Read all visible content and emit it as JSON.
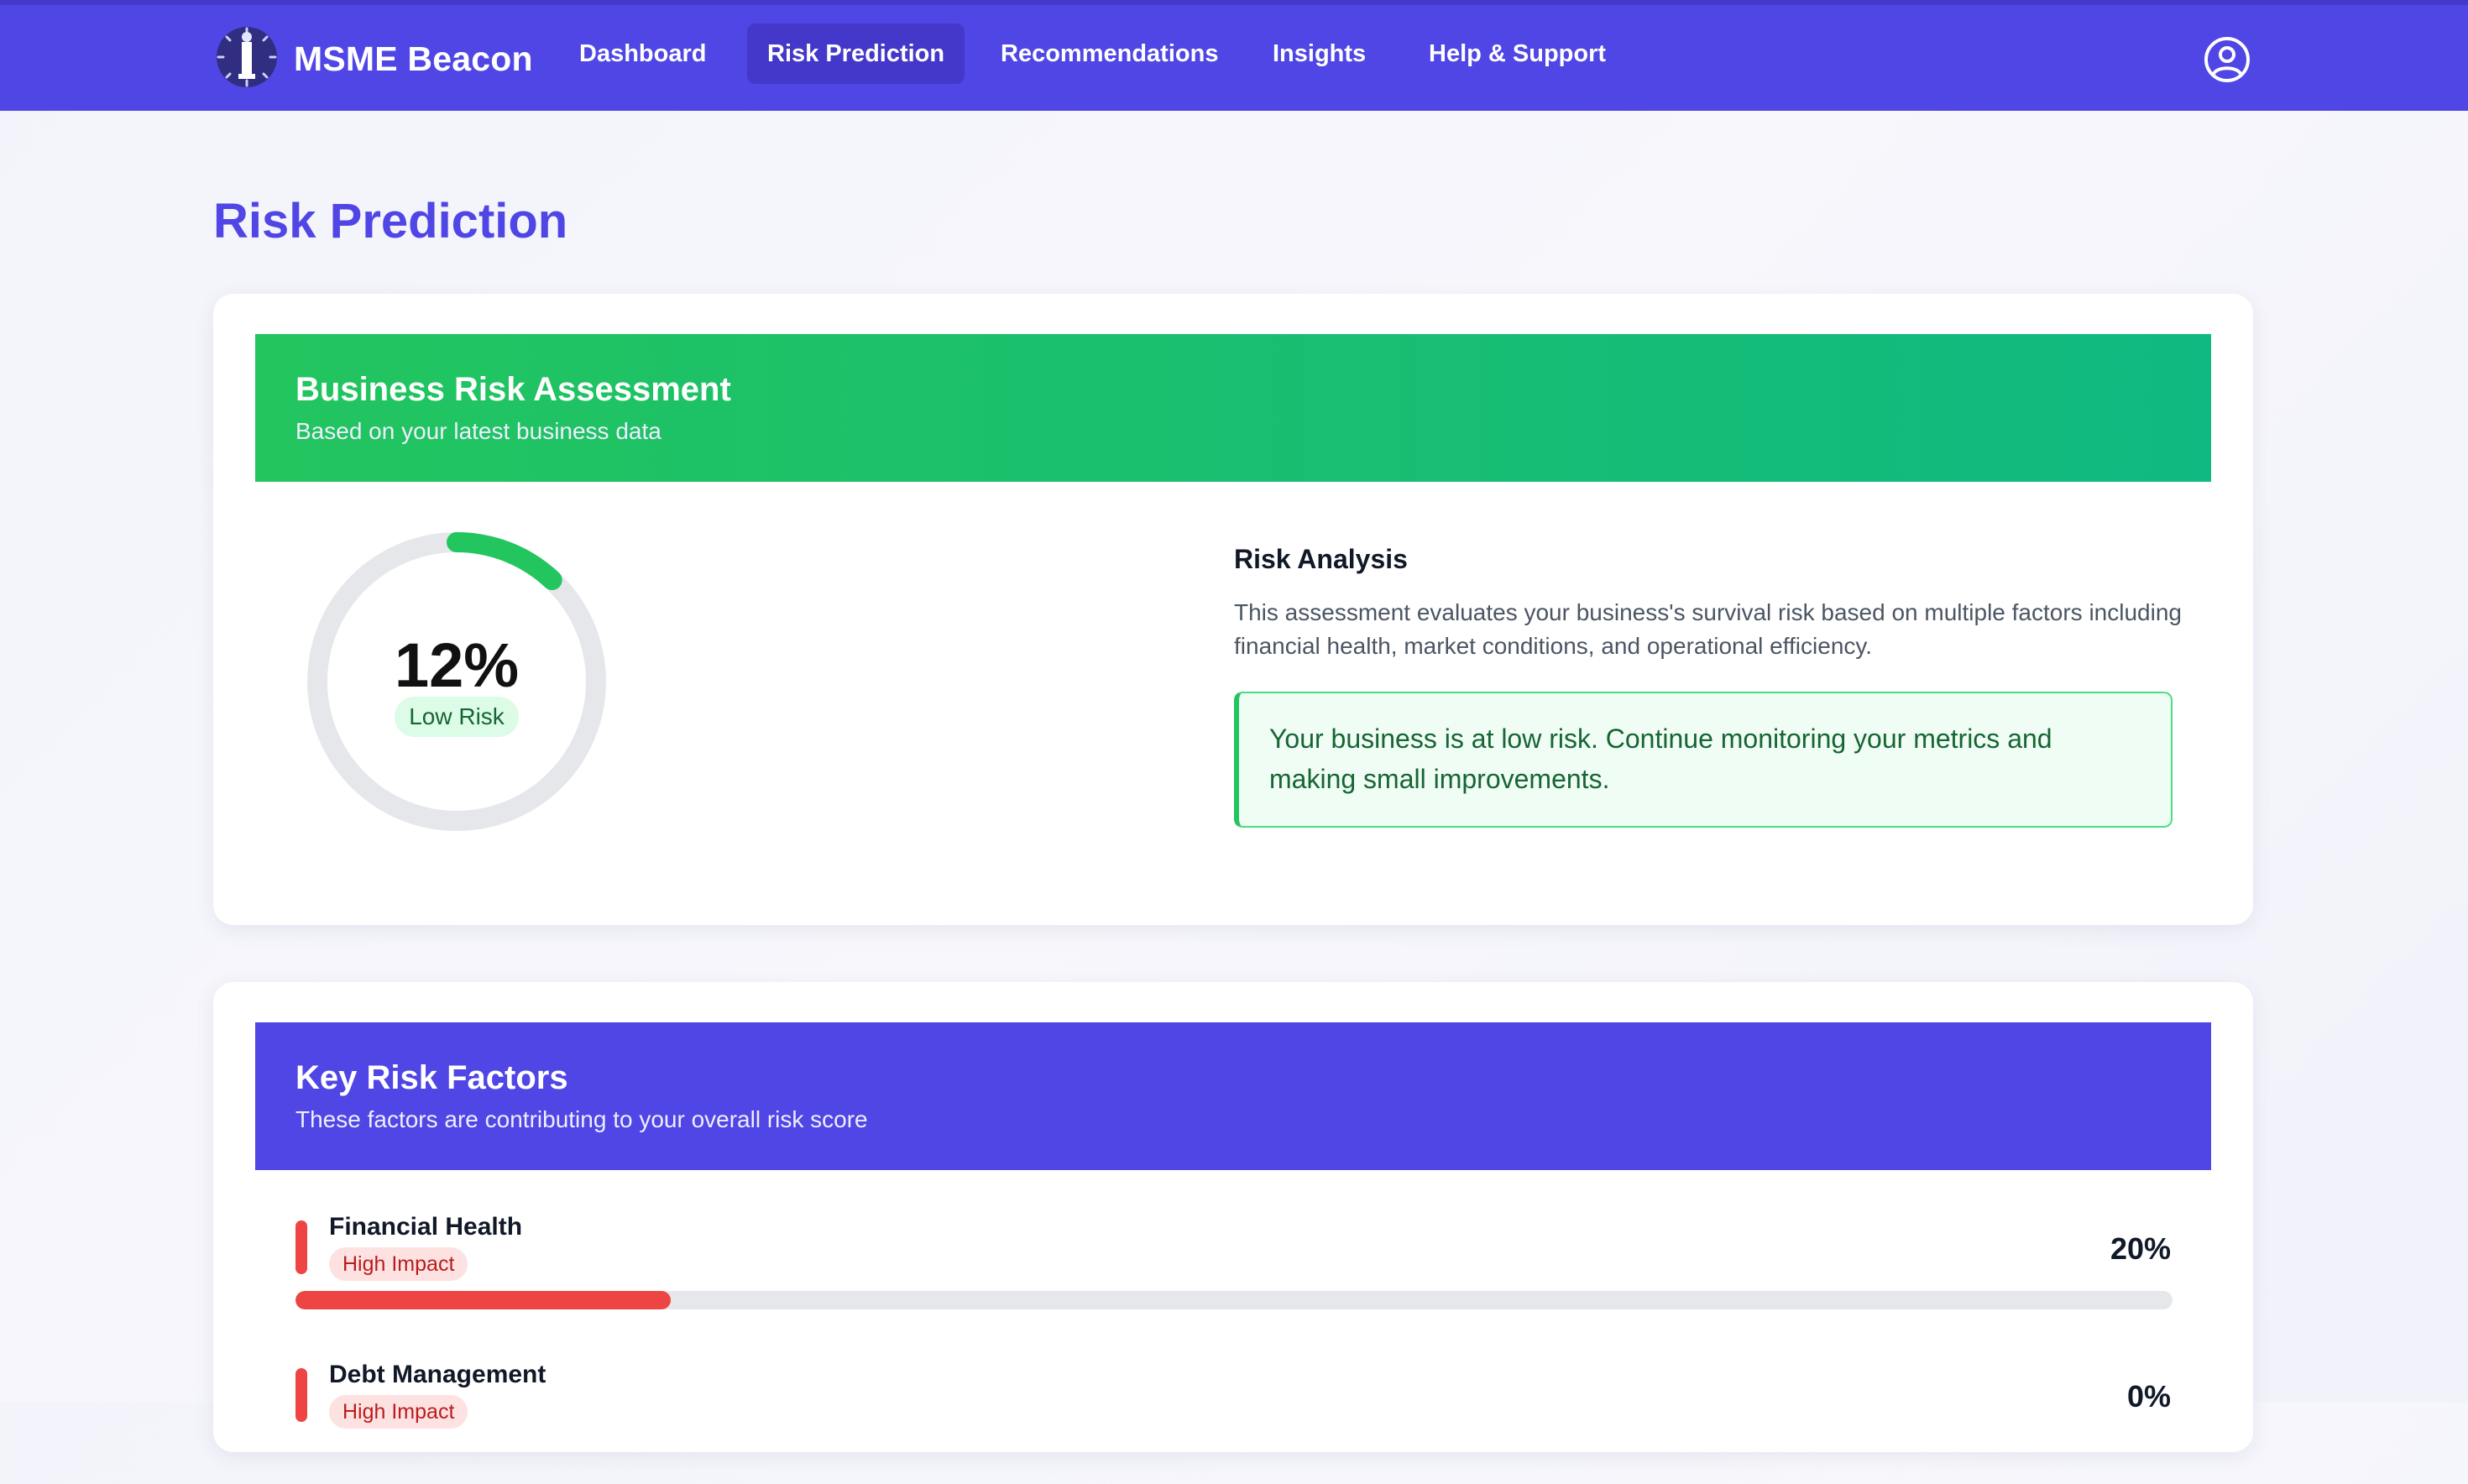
{
  "nav": {
    "brand": "MSME Beacon",
    "items": [
      {
        "label": "Dashboard",
        "active": false
      },
      {
        "label": "Risk Prediction",
        "active": true
      },
      {
        "label": "Recommendations",
        "active": false
      },
      {
        "label": "Insights",
        "active": false
      },
      {
        "label": "Help & Support",
        "active": false
      }
    ],
    "logo_icon": "lighthouse-beacon-icon",
    "user_icon": "user-circle-icon"
  },
  "page": {
    "title": "Risk Prediction"
  },
  "assessment": {
    "header_title": "Business Risk Assessment",
    "header_subtitle": "Based on your latest business data",
    "risk_percent": "12%",
    "risk_value": 0.12,
    "risk_label": "Low Risk",
    "analysis_title": "Risk Analysis",
    "analysis_text": "This assessment evaluates your business's survival risk based on multiple factors including financial health, market conditions, and operational efficiency.",
    "recommendation": "Your business is at low risk. Continue monitoring your metrics and making small improvements.",
    "colors": {
      "header_start": "#22c55e",
      "header_end": "#10b981",
      "gauge": "#22c55e"
    }
  },
  "factors": {
    "header_title": "Key Risk Factors",
    "header_subtitle": "These factors are contributing to your overall risk score",
    "items": [
      {
        "name": "Financial Health",
        "impact": "High Impact",
        "percent": "20%",
        "value": 0.2
      },
      {
        "name": "Debt Management",
        "impact": "High Impact",
        "percent": "0%",
        "value": 0.0
      }
    ],
    "colors": {
      "header": "#4f46e5",
      "high": "#ef4444"
    }
  }
}
